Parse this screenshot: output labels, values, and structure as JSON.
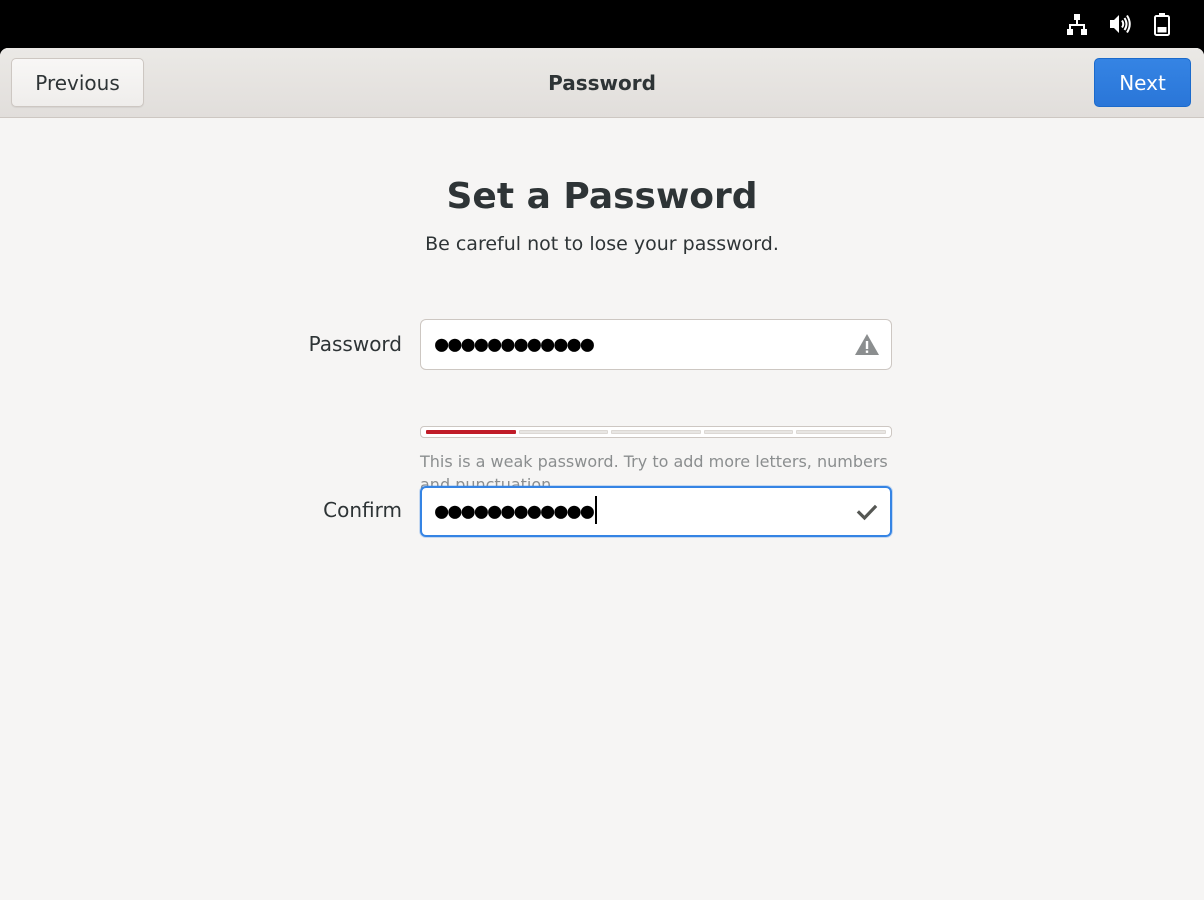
{
  "header": {
    "title": "Password",
    "previous_label": "Previous",
    "next_label": "Next"
  },
  "page": {
    "title": "Set a Password",
    "subtitle": "Be careful not to lose your password."
  },
  "password_field": {
    "label": "Password",
    "value_masked": "●●●●●●●●●●●●",
    "status_icon": "warning-icon",
    "strength_level": 1,
    "strength_segments": 5,
    "hint": "This is a weak password. Try to add more letters, numbers and punctuation."
  },
  "confirm_field": {
    "label": "Confirm",
    "value_masked": "●●●●●●●●●●●●",
    "status_icon": "checkmark-icon",
    "focused": true
  },
  "system_tray": {
    "icons": [
      "network-icon",
      "volume-icon",
      "battery-icon"
    ]
  },
  "colors": {
    "accent": "#3584e4",
    "weak_strength": "#c01c28",
    "text": "#2e3436",
    "hint": "#8b8e8f",
    "background": "#f6f5f4"
  }
}
